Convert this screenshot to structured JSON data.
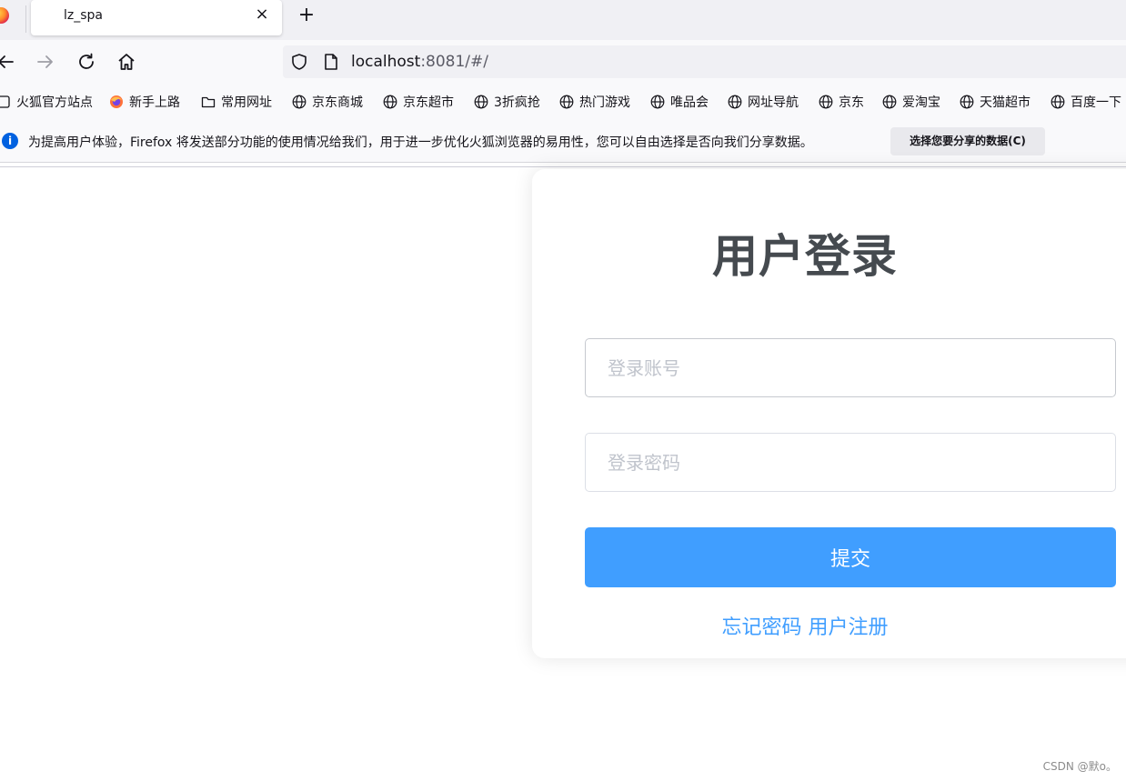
{
  "browser": {
    "tab_title": "lz_spa",
    "close_glyph": "×",
    "new_tab_glyph": "+",
    "url_host": "localhost",
    "url_rest": ":8081/#/",
    "bookmarks": [
      {
        "label": "火狐官方站点",
        "icon": "bookmark-page-icon"
      },
      {
        "label": "新手上路",
        "icon": "firefox-icon"
      },
      {
        "label": "常用网址",
        "icon": "folder-icon"
      },
      {
        "label": "京东商城",
        "icon": "globe-icon"
      },
      {
        "label": "京东超市",
        "icon": "globe-icon"
      },
      {
        "label": "3折疯抢",
        "icon": "globe-icon"
      },
      {
        "label": "热门游戏",
        "icon": "globe-icon"
      },
      {
        "label": "唯品会",
        "icon": "globe-icon"
      },
      {
        "label": "网址导航",
        "icon": "globe-icon"
      },
      {
        "label": "京东",
        "icon": "globe-icon"
      },
      {
        "label": "爱淘宝",
        "icon": "globe-icon"
      },
      {
        "label": "天猫超市",
        "icon": "globe-icon"
      },
      {
        "label": "百度一下",
        "icon": "globe-icon"
      }
    ],
    "info_text": "为提高用户体验，Firefox 将发送部分功能的使用情况给我们，用于进一步优化火狐浏览器的易用性，您可以自由选择是否向我们分享数据。",
    "info_button": "选择您要分享的数据(C)",
    "info_icon_glyph": "i"
  },
  "login": {
    "title": "用户登录",
    "username_placeholder": "登录账号",
    "password_placeholder": "登录密码",
    "submit_label": "提交",
    "forgot_label": "忘记密码",
    "register_label": "用户注册"
  },
  "watermark": "CSDN @默o。",
  "colors": {
    "primary": "#409eff",
    "title": "#454a4f",
    "info_blue": "#0061e0"
  }
}
